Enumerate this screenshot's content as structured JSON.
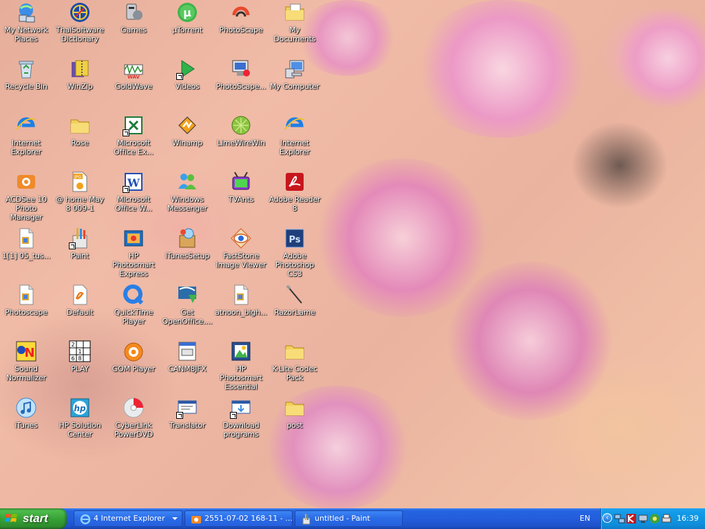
{
  "desktop": {
    "icons": [
      {
        "label": "My Network Places",
        "icon": "network-places-icon"
      },
      {
        "label": "ThaiSoftware Dictionary",
        "icon": "dictionary-icon"
      },
      {
        "label": "Games",
        "icon": "games-icon"
      },
      {
        "label": "µTorrent",
        "icon": "utorrent-icon"
      },
      {
        "label": "PhotoScape",
        "icon": "photoscape-icon"
      },
      {
        "label": "My Documents",
        "icon": "my-documents-icon"
      },
      {
        "label": "Recycle Bin",
        "icon": "recycle-bin-icon"
      },
      {
        "label": "WinZip",
        "icon": "winzip-icon"
      },
      {
        "label": "GoldWave",
        "icon": "goldwave-icon"
      },
      {
        "label": "Videos",
        "icon": "videos-icon"
      },
      {
        "label": "PhotoScape...",
        "icon": "photoscape-shortcut-icon"
      },
      {
        "label": "My Computer",
        "icon": "my-computer-icon"
      },
      {
        "label": "Internet Explorer",
        "icon": "internet-explorer-icon"
      },
      {
        "label": "Rose",
        "icon": "folder-icon"
      },
      {
        "label": "Microsoft Office Ex...",
        "icon": "excel-icon"
      },
      {
        "label": "Winamp",
        "icon": "winamp-icon"
      },
      {
        "label": "LimeWireWin",
        "icon": "limewire-icon"
      },
      {
        "label": "Internet Explorer",
        "icon": "internet-explorer-icon"
      },
      {
        "label": "ACDSee 10 Photo Manager",
        "icon": "acdsee-icon"
      },
      {
        "label": "@ home May 8 009-1",
        "icon": "jpg-file-icon"
      },
      {
        "label": "Microsoft Office W...",
        "icon": "word-icon"
      },
      {
        "label": "Windows Messenger",
        "icon": "messenger-icon"
      },
      {
        "label": "TVAnts",
        "icon": "tvants-icon"
      },
      {
        "label": "Adobe Reader 8",
        "icon": "adobe-reader-icon"
      },
      {
        "label": "1[1] 05_tus...",
        "icon": "file-icon"
      },
      {
        "label": "Paint",
        "icon": "paint-icon"
      },
      {
        "label": "HP Photosmart Express",
        "icon": "hp-photosmart-express-icon"
      },
      {
        "label": "iTunesSetup",
        "icon": "itunes-setup-icon"
      },
      {
        "label": "FastStone Image Viewer",
        "icon": "faststone-icon"
      },
      {
        "label": "Adobe Photoshop CS3",
        "icon": "photoshop-icon"
      },
      {
        "label": "Photoscape",
        "icon": "file-icon"
      },
      {
        "label": "Default",
        "icon": "default-file-icon"
      },
      {
        "label": "QuickTime Player",
        "icon": "quicktime-icon"
      },
      {
        "label": "Get OpenOffice....",
        "icon": "openoffice-icon"
      },
      {
        "label": "atnoon_bigh...",
        "icon": "file-icon"
      },
      {
        "label": "RazorLame",
        "icon": "razorlame-icon"
      },
      {
        "label": "Sound Normalizer",
        "icon": "sound-normalizer-icon"
      },
      {
        "label": "PLAY",
        "icon": "sudoku-icon"
      },
      {
        "label": "GOM Player",
        "icon": "gom-player-icon"
      },
      {
        "label": "CANM8JFX",
        "icon": "canm8jfx-icon"
      },
      {
        "label": "HP Photosmart Essential",
        "icon": "hp-photosmart-essential-icon"
      },
      {
        "label": "K-Lite Codec Pack",
        "icon": "folder-icon"
      },
      {
        "label": "iTunes",
        "icon": "itunes-icon"
      },
      {
        "label": "HP Solution Center",
        "icon": "hp-solution-center-icon"
      },
      {
        "label": "CyberLink PowerDVD",
        "icon": "powerdvd-icon"
      },
      {
        "label": "Translator",
        "icon": "translator-icon"
      },
      {
        "label": "Download programs",
        "icon": "download-programs-icon"
      },
      {
        "label": "post",
        "icon": "folder-icon"
      }
    ]
  },
  "taskbar": {
    "start_label": "start",
    "tasks": [
      {
        "label": "4 Internet Explorer",
        "icon": "internet-explorer-icon",
        "grouped": true
      },
      {
        "label": "2551-07-02 168-11 - ...",
        "icon": "acdsee-icon",
        "grouped": false
      },
      {
        "label": "untitled - Paint",
        "icon": "paint-icon",
        "grouped": false
      }
    ],
    "language": "EN",
    "tray_icons": [
      "show-hidden-icons-icon",
      "network-icon",
      "kaspersky-icon",
      "network-connection-icon",
      "hp-icon",
      "messenger-tray-icon",
      "printer-icon"
    ],
    "clock": "16:39"
  },
  "colors": {
    "taskbar_blue": "#245edc",
    "start_green": "#38a236",
    "tray_blue": "#129be8",
    "label_text": "#ffffff"
  }
}
